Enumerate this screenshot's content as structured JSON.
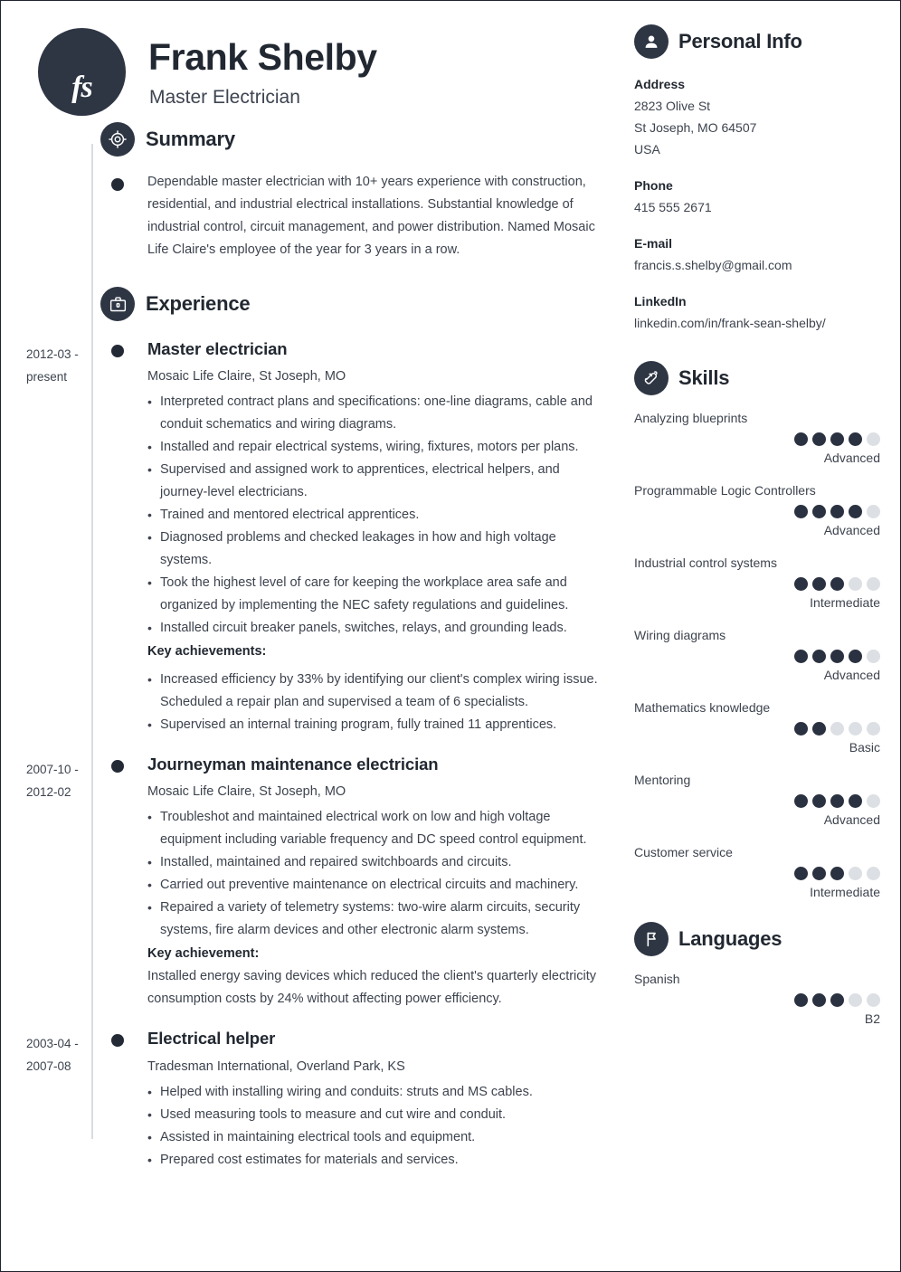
{
  "header": {
    "initials": "fs",
    "name": "Frank Shelby",
    "job_title": "Master Electrician"
  },
  "summary": {
    "icon": "target-icon",
    "title": "Summary",
    "text": "Dependable master electrician with 10+ years experience with construction, residential, and industrial electrical installations. Substantial knowledge of industrial control, circuit management, and power distribution. Named Mosaic Life Claire's employee of the year for 3 years in a row."
  },
  "experience": {
    "icon": "briefcase-icon",
    "title": "Experience",
    "entries": [
      {
        "dates": "2012-03 - present",
        "role": "Master electrician",
        "company": "Mosaic Life Claire, St Joseph, MO",
        "bullets": [
          "Interpreted contract plans and specifications: one-line diagrams, cable and conduit schematics and wiring diagrams.",
          "Installed and repair electrical systems, wiring, fixtures, motors per plans.",
          "Supervised and assigned work to apprentices, electrical helpers, and journey-level electricians.",
          "Trained and mentored electrical apprentices.",
          "Diagnosed problems and checked leakages in how and high voltage systems.",
          "Took the highest level of care for keeping the workplace area safe and organized by implementing the NEC safety regulations and guidelines.",
          "Installed circuit breaker panels, switches, relays, and grounding leads."
        ],
        "achievements_label": "Key achievements:",
        "achievements": [
          "Increased efficiency by 33% by identifying our client's complex wiring issue. Scheduled a repair plan and supervised a team of 6 specialists.",
          "Supervised an internal training program, fully trained 11 apprentices."
        ],
        "achievement_paragraph": ""
      },
      {
        "dates": "2007-10 - 2012-02",
        "role": "Journeyman maintenance electrician",
        "company": "Mosaic Life Claire, St Joseph, MO",
        "bullets": [
          "Troubleshot and maintained electrical work on low and high voltage equipment including variable frequency and DC speed control equipment.",
          "Installed, maintained and repaired switchboards and circuits.",
          "Carried out preventive maintenance on electrical circuits and machinery.",
          "Repaired a variety of telemetry systems: two-wire alarm circuits, security systems, fire alarm devices and other electronic alarm systems."
        ],
        "achievements_label": "Key achievement:",
        "achievements": [],
        "achievement_paragraph": "Installed energy saving devices which reduced the client's quarterly electricity consumption costs by 24% without affecting power efficiency."
      },
      {
        "dates": "2003-04 - 2007-08",
        "role": "Electrical helper",
        "company": "Tradesman International, Overland Park, KS",
        "bullets": [
          "Helped with installing wiring and conduits: struts and MS cables.",
          "Used measuring tools to measure and cut wire and conduit.",
          "Assisted in maintaining electrical tools and equipment.",
          "Prepared cost estimates for materials and services."
        ],
        "achievements_label": "",
        "achievements": [],
        "achievement_paragraph": ""
      }
    ]
  },
  "personal_info": {
    "icon": "person-icon",
    "title": "Personal Info",
    "blocks": [
      {
        "label": "Address",
        "values": [
          "2823 Olive St",
          "St Joseph, MO 64507",
          "USA"
        ]
      },
      {
        "label": "Phone",
        "values": [
          "415 555 2671"
        ]
      },
      {
        "label": "E-mail",
        "values": [
          "francis.s.shelby@gmail.com"
        ]
      },
      {
        "label": "LinkedIn",
        "values": [
          "linkedin.com/in/frank-sean-shelby/"
        ]
      }
    ]
  },
  "skills": {
    "icon": "puzzle-heart-icon",
    "title": "Skills",
    "max_dots": 5,
    "items": [
      {
        "name": "Analyzing blueprints",
        "filled": 4,
        "level": "Advanced"
      },
      {
        "name": "Programmable Logic Controllers",
        "filled": 4,
        "level": "Advanced"
      },
      {
        "name": "Industrial control systems",
        "filled": 3,
        "level": "Intermediate"
      },
      {
        "name": "Wiring diagrams",
        "filled": 4,
        "level": "Advanced"
      },
      {
        "name": "Mathematics knowledge",
        "filled": 2,
        "level": "Basic"
      },
      {
        "name": "Mentoring",
        "filled": 4,
        "level": "Advanced"
      },
      {
        "name": "Customer service",
        "filled": 3,
        "level": "Intermediate"
      }
    ]
  },
  "languages": {
    "icon": "flag-icon",
    "title": "Languages",
    "max_dots": 5,
    "items": [
      {
        "name": "Spanish",
        "filled": 3,
        "level": "B2"
      }
    ]
  },
  "colors": {
    "accent_dark": "#2e3644",
    "text_dark": "#222831",
    "text_body": "#3d434e",
    "dot_off": "#dcdfe3",
    "dot_on": "#2a3140",
    "spine": "#d9dce1"
  }
}
